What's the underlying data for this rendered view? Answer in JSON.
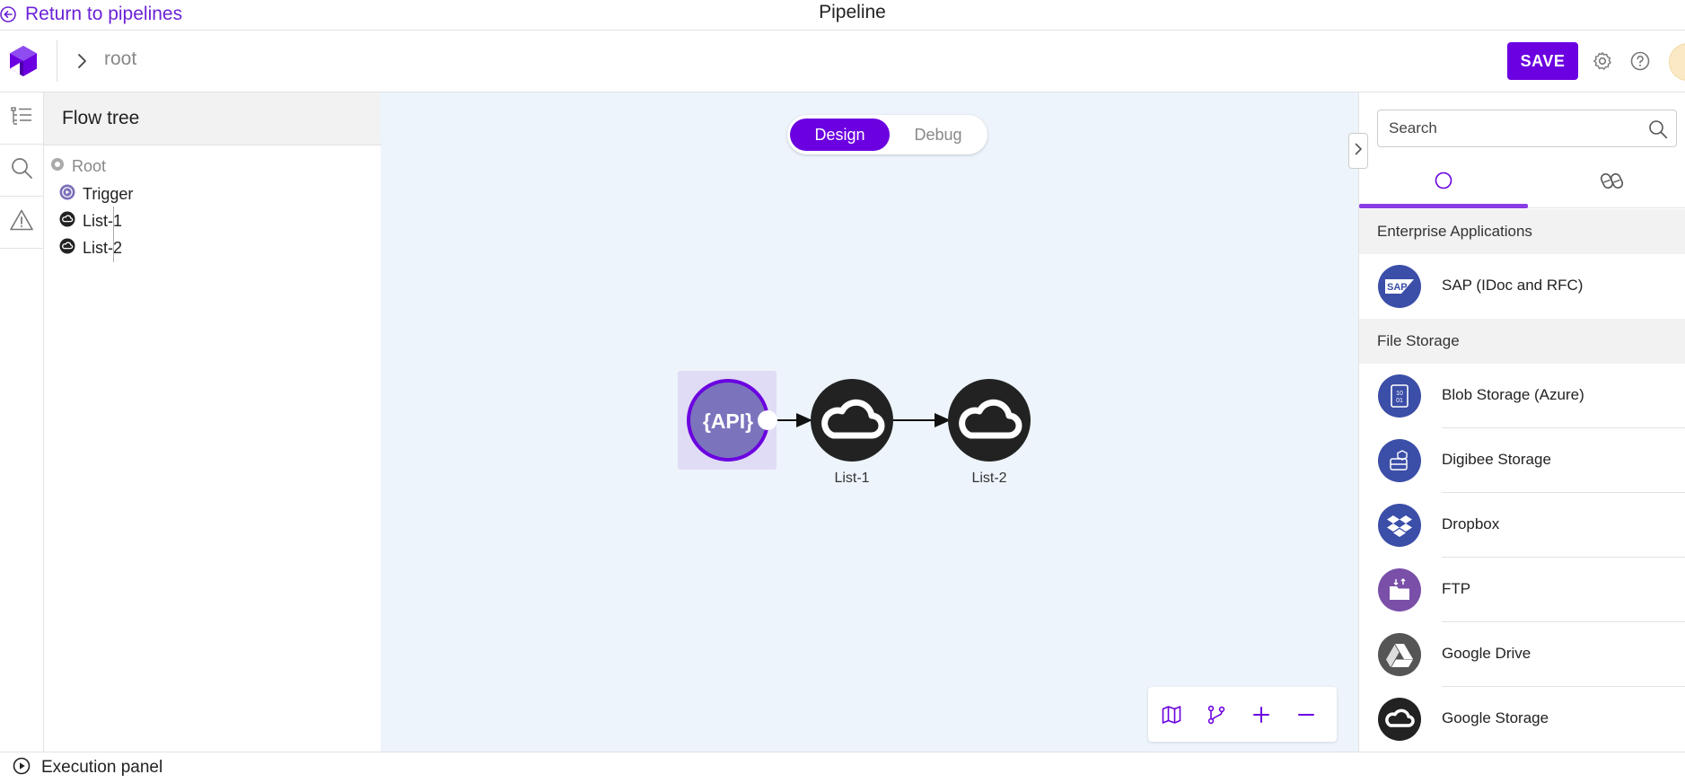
{
  "topbar": {
    "return_label": "Return to pipelines",
    "title": "Pipeline"
  },
  "header": {
    "breadcrumb": "root",
    "save_label": "SAVE",
    "icons": [
      "logo-icon",
      "chevron-right-icon",
      "gear-icon",
      "help-icon"
    ]
  },
  "rail": {
    "icons": [
      "flow-tree-icon",
      "search-icon",
      "warning-icon"
    ]
  },
  "flow_tree": {
    "title": "Flow tree",
    "items": [
      {
        "label": "Root",
        "icon": "root-dot-icon"
      },
      {
        "label": "Trigger",
        "icon": "trigger-play-icon"
      },
      {
        "label": "List-1",
        "icon": "cloud-icon"
      },
      {
        "label": "List-2",
        "icon": "cloud-icon"
      }
    ]
  },
  "canvas": {
    "mode_design": "Design",
    "mode_debug": "Debug",
    "trigger_text": "{API}",
    "nodes": [
      {
        "label": "List-1"
      },
      {
        "label": "List-2"
      }
    ],
    "zoom_controls": [
      "map-icon",
      "branch-icon",
      "zoom-in-icon",
      "zoom-out-icon"
    ]
  },
  "palette": {
    "search_placeholder": "Search",
    "sections": [
      {
        "title": "Enterprise Applications",
        "items": [
          {
            "label": "SAP (IDoc and RFC)",
            "icon_text": "SAP",
            "color": "#3b4ea8"
          }
        ]
      },
      {
        "title": "File Storage",
        "items": [
          {
            "label": "Blob Storage (Azure)",
            "icon_text": "10 01",
            "color": "#3b4ea8"
          },
          {
            "label": "Digibee Storage",
            "color": "#3b4ea8"
          },
          {
            "label": "Dropbox",
            "color": "#3b4ea8"
          },
          {
            "label": "FTP",
            "color": "#7a4fa8"
          },
          {
            "label": "Google Drive",
            "color": "#555555"
          },
          {
            "label": "Google Storage",
            "color": "#222222"
          }
        ]
      }
    ]
  },
  "bottom": {
    "execution_label": "Execution panel"
  },
  "colors": {
    "accent": "#6b00e0",
    "link": "#6b22d6",
    "canvas_bg": "#edf4fb"
  }
}
